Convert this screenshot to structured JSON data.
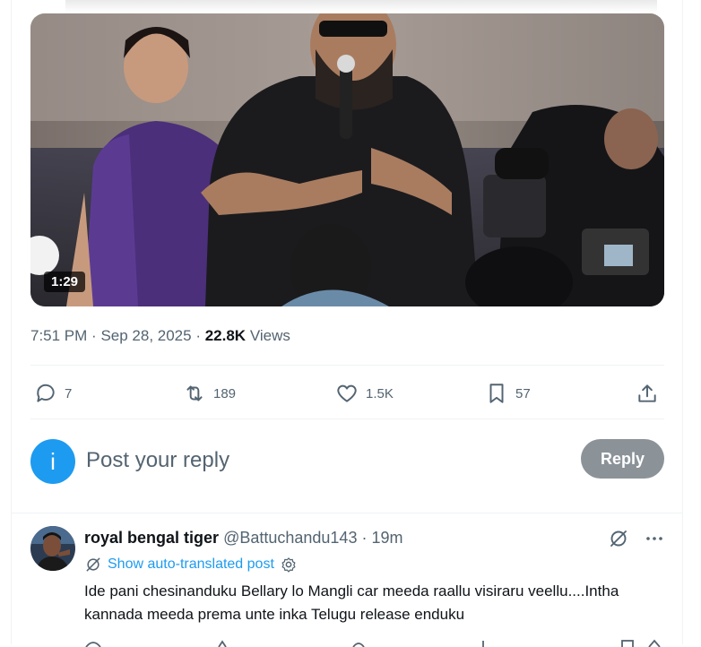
{
  "video": {
    "duration": "1:29"
  },
  "tweet_meta": {
    "time": "7:51 PM",
    "date": "Sep 28, 2025",
    "views_count": "22.8K",
    "views_label": "Views"
  },
  "actions": {
    "replies": "7",
    "reposts": "189",
    "likes": "1.5K",
    "bookmarks": "57"
  },
  "reply_box": {
    "avatar_letter": "i",
    "placeholder": "Post your reply",
    "button": "Reply"
  },
  "reply": {
    "name": "royal bengal tiger",
    "handle": "@Battuchandu143",
    "time": "19m",
    "translate_label": "Show auto-translated post",
    "text": "Ide pani chesinanduku Bellary lo Mangli car meeda raallu visiraru veellu....Intha kannada meeda prema unte inka Telugu release enduku"
  },
  "colors": {
    "accent": "#1d9bf0",
    "secondary_text": "#536471",
    "reply_button": "#8b9399"
  },
  "icons": [
    "reply-icon",
    "repost-icon",
    "like-icon",
    "bookmark-icon",
    "share-icon",
    "grok-icon",
    "more-icon",
    "translate-icon",
    "gear-icon"
  ]
}
